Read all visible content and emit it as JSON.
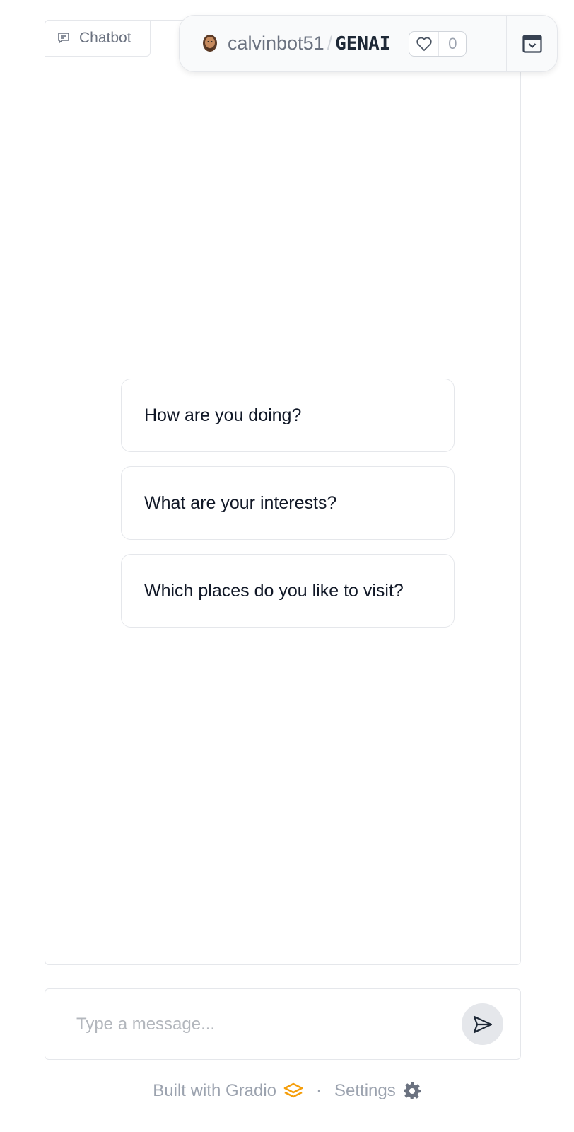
{
  "chat": {
    "label": "Chatbot",
    "suggestions": [
      "How are you doing?",
      "What are your interests?",
      "Which places do you like to visit?"
    ]
  },
  "space_header": {
    "owner": "calvinbot51",
    "separator": "/",
    "space_name": "GENAI",
    "likes": "0"
  },
  "input": {
    "placeholder": "Type a message..."
  },
  "footer": {
    "built_with": "Built with Gradio",
    "separator": "·",
    "settings": "Settings"
  },
  "icons": {
    "chat_label": "chat-bubble-icon",
    "avatar": "user-avatar-icon",
    "like": "heart-icon",
    "collapse": "collapse-window-icon",
    "send": "send-arrow-icon",
    "gradio_logo": "gradio-logo-icon",
    "settings": "gear-icon"
  },
  "colors": {
    "accent_gradio": "#f59e0b",
    "border": "#e5e7eb",
    "text_muted": "#9ca3af"
  }
}
